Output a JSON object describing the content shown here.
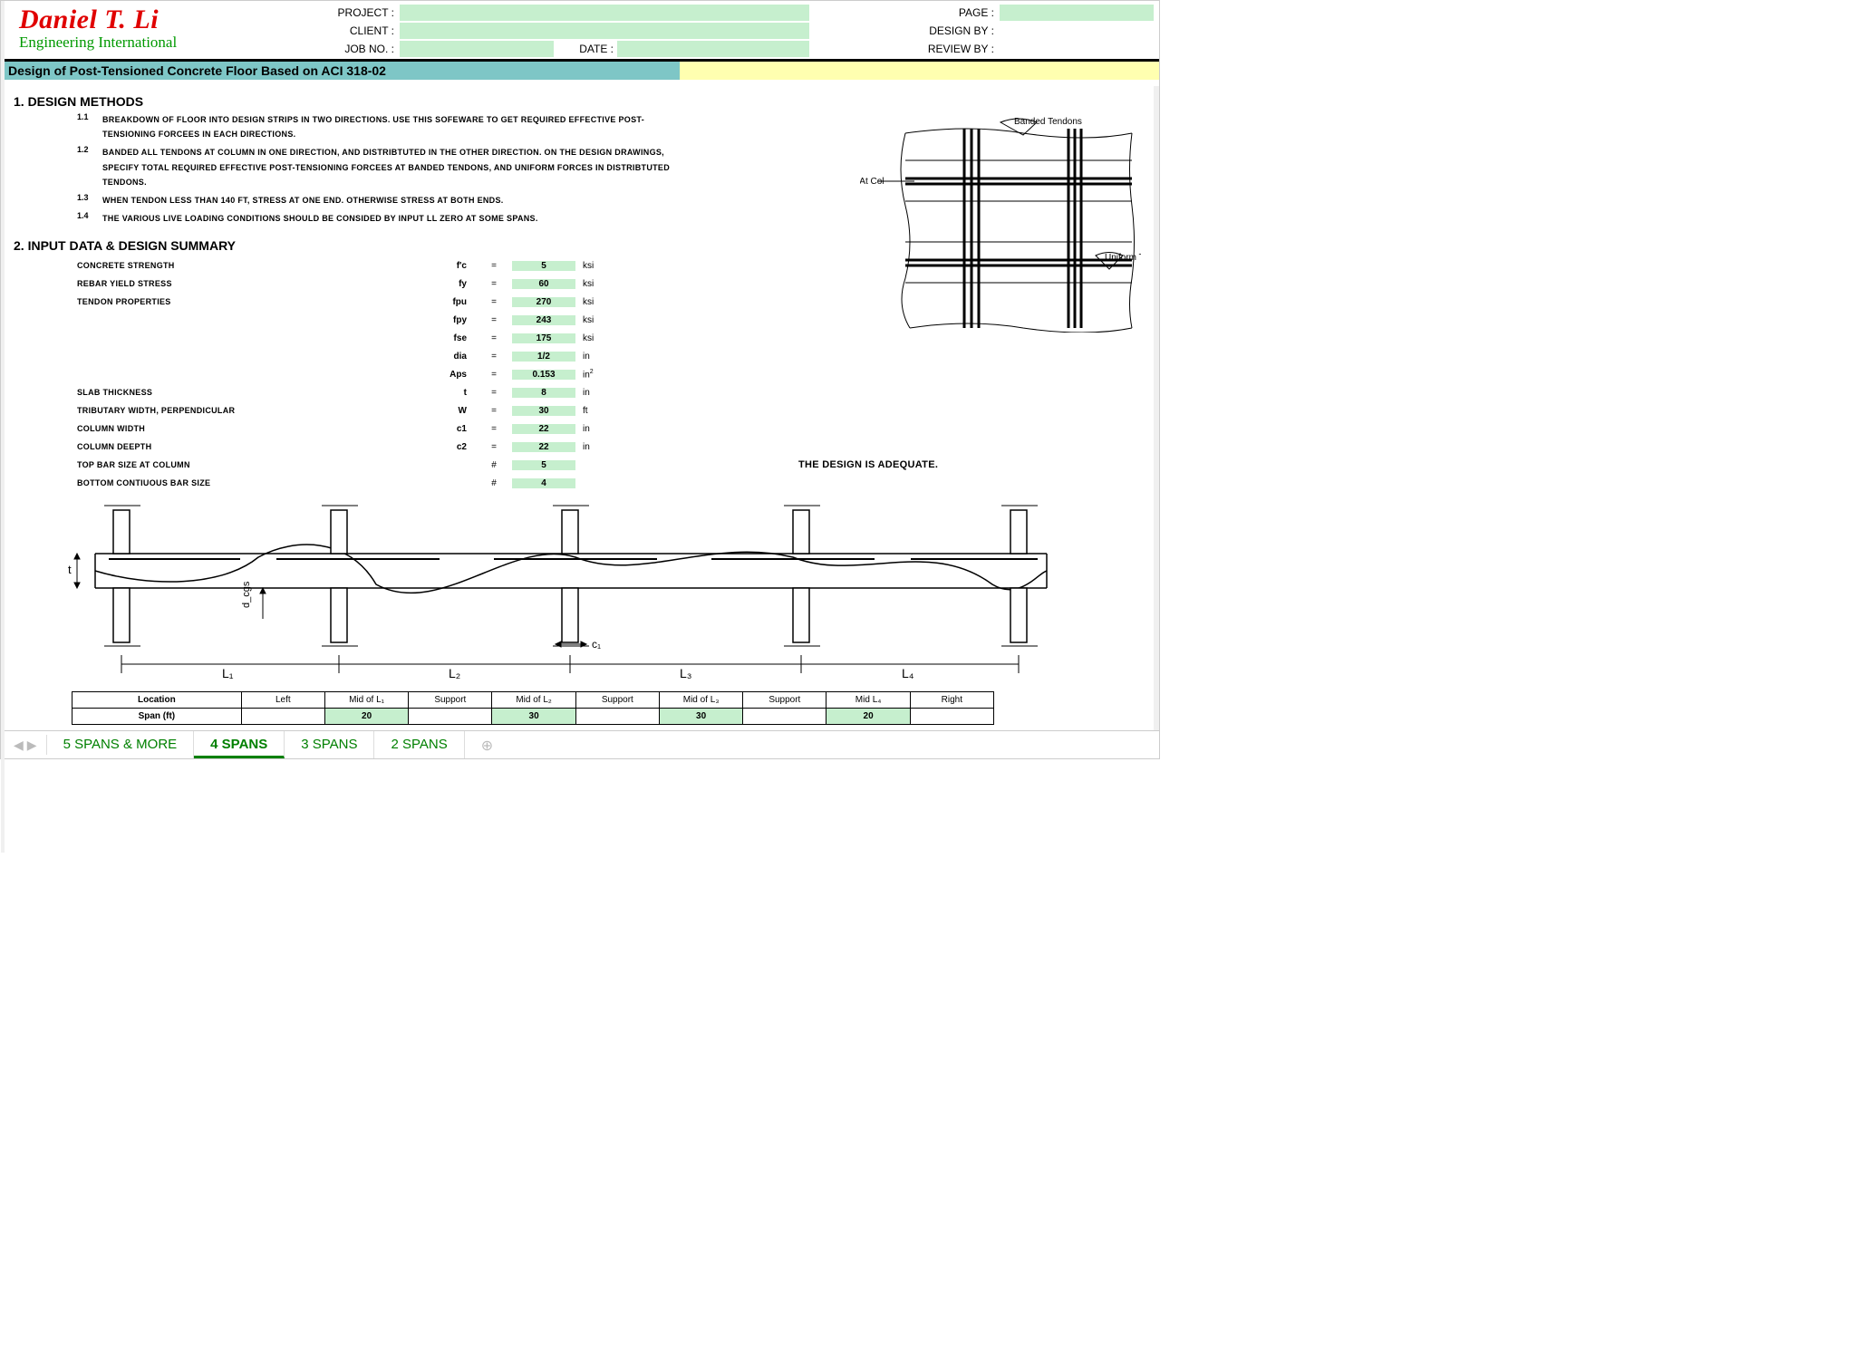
{
  "logo": {
    "name": "Daniel T. Li",
    "sub": "Engineering International"
  },
  "header": {
    "project_lbl": "PROJECT :",
    "client_lbl": "CLIENT :",
    "jobno_lbl": "JOB NO. :",
    "date_lbl": "DATE :",
    "page_lbl": "PAGE :",
    "design_lbl": "DESIGN BY :",
    "review_lbl": "REVIEW BY :"
  },
  "title": "Design of Post-Tensioned Concrete Floor Based on ACI 318-02",
  "section1": {
    "heading": "1. DESIGN METHODS",
    "items": [
      {
        "n": "1.1",
        "t": "BREAKDOWN OF FLOOR INTO DESIGN STRIPS IN TWO DIRECTIONS. USE THIS SOFEWARE TO GET REQUIRED EFFECTIVE POST-TENSIONING FORCEES IN EACH DIRECTIONS."
      },
      {
        "n": "1.2",
        "t": "BANDED ALL TENDONS AT COLUMN IN ONE DIRECTION, AND DISTRIBTUTED IN THE OTHER DIRECTION. ON THE DESIGN DRAWINGS, SPECIFY TOTAL REQUIRED EFFECTIVE POST-TENSIONING FORCEES AT BANDED TENDONS, AND UNIFORM FORCES IN DISTRIBTUTED TENDONS."
      },
      {
        "n": "1.3",
        "t": "WHEN TENDON LESS THAN 140 FT, STRESS AT ONE END. OTHERWISE STRESS AT BOTH ENDS."
      },
      {
        "n": "1.4",
        "t": "THE VARIOUS LIVE LOADING CONDITIONS SHOULD BE CONSIDED BY INPUT LL ZERO AT SOME SPANS."
      }
    ]
  },
  "section2": {
    "heading": "2. INPUT DATA & DESIGN SUMMARY",
    "rows": [
      {
        "label": "CONCRETE STRENGTH",
        "sym": "f'c",
        "eq": "=",
        "val": "5",
        "unit": "ksi"
      },
      {
        "label": "REBAR YIELD STRESS",
        "sym": "fy",
        "eq": "=",
        "val": "60",
        "unit": "ksi"
      },
      {
        "label": "TENDON PROPERTIES",
        "sym": "fpu",
        "eq": "=",
        "val": "270",
        "unit": "ksi"
      },
      {
        "label": "",
        "sym": "fpy",
        "eq": "=",
        "val": "243",
        "unit": "ksi"
      },
      {
        "label": "",
        "sym": "fse",
        "eq": "=",
        "val": "175",
        "unit": "ksi"
      },
      {
        "label": "",
        "sym": "dia",
        "eq": "=",
        "val": "1/2",
        "unit": "in"
      },
      {
        "label": "",
        "sym": "Aps",
        "eq": "=",
        "val": "0.153",
        "unit": "in²"
      },
      {
        "label": "SLAB THICKNESS",
        "sym": "t",
        "eq": "=",
        "val": "8",
        "unit": "in"
      },
      {
        "label": "TRIBUTARY WIDTH, PERPENDICULAR",
        "sym": "W",
        "eq": "=",
        "val": "30",
        "unit": "ft"
      },
      {
        "label": "COLUMN WIDTH",
        "sym": "c1",
        "eq": "=",
        "val": "22",
        "unit": "in"
      },
      {
        "label": "COLUMN DEEPTH",
        "sym": "c2",
        "eq": "=",
        "val": "22",
        "unit": "in"
      },
      {
        "label": "TOP BAR SIZE AT COLUMN",
        "sym": "",
        "eq": "#",
        "val": "5",
        "unit": ""
      },
      {
        "label": "BOTTOM CONTIUOUS BAR SIZE",
        "sym": "",
        "eq": "#",
        "val": "4",
        "unit": ""
      }
    ],
    "adequate": "THE DESIGN IS ADEQUATE."
  },
  "diagram_labels": {
    "banded": "Banded Tendons",
    "mintwo": "Min Two At Col",
    "uniform": "Uniform Tendons",
    "t": "t",
    "dcgs": "d_cgs",
    "c1": "c₁",
    "L1": "L₁",
    "L2": "L₂",
    "L3": "L₃",
    "L4": "L₄"
  },
  "span_table": {
    "headers": [
      "Location",
      "Left",
      "Mid of L₁",
      "Support",
      "Mid of L₂",
      "Support",
      "Mid of L₃",
      "Support",
      "Mid L₄",
      "Right"
    ],
    "row1_label": "Span (ft)",
    "row1": [
      "",
      "20",
      "",
      "30",
      "",
      "30",
      "",
      "20",
      ""
    ]
  },
  "tabs": {
    "items": [
      "5 SPANS & MORE",
      "4 SPANS",
      "3 SPANS",
      "2 SPANS"
    ],
    "active": "4 SPANS"
  }
}
